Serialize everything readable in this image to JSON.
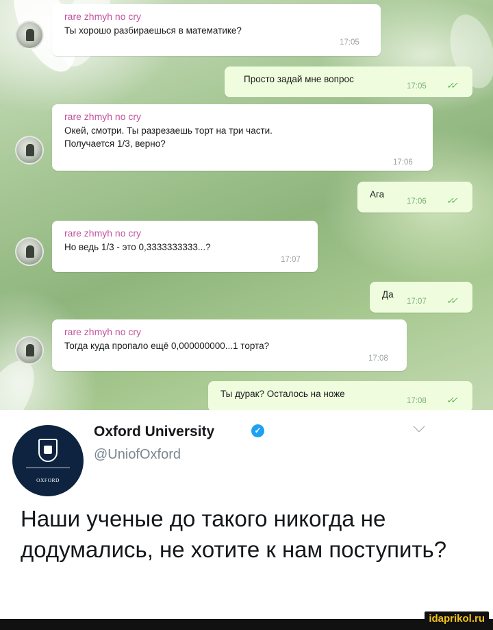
{
  "chat": {
    "sender_name": "rare zhmyh no cry",
    "messages": [
      {
        "text": "Ты хорошо разбираешься в математике?",
        "time": "17:05"
      },
      {
        "text": "Просто задай мне вопрос",
        "time": "17:05"
      },
      {
        "text": "Окей, смотри. Ты разрезаешь торт на три части.\nПолучается 1/3, верно?",
        "time": "17:06"
      },
      {
        "text": "Ага",
        "time": "17:06"
      },
      {
        "text": "Но ведь 1/3 - это 0,3333333333...?",
        "time": "17:07"
      },
      {
        "text": "Да",
        "time": "17:07"
      },
      {
        "text": "Тогда куда пропало ещё 0,000000000...1 торта?",
        "time": "17:08"
      },
      {
        "text": "Ты дурак? Осталось на ноже",
        "time": "17:08"
      }
    ],
    "read_ticks": "✓✓"
  },
  "tweet": {
    "account_name": "Oxford University",
    "verified_mark": "✓",
    "handle": "@UniofOxford",
    "logo_text": "OXFORD",
    "text": "Наши ученые до такого никогда не додумались, не хотите к нам поступить?"
  },
  "watermark": "idaprikol.ru",
  "colors": {
    "sender": "#c2539b",
    "outgoing_bubble": "#effdde",
    "ticks": "#4fae4e",
    "oxford_blue": "#0d2340",
    "verified": "#1da1f2",
    "watermark": "#f3c316"
  }
}
